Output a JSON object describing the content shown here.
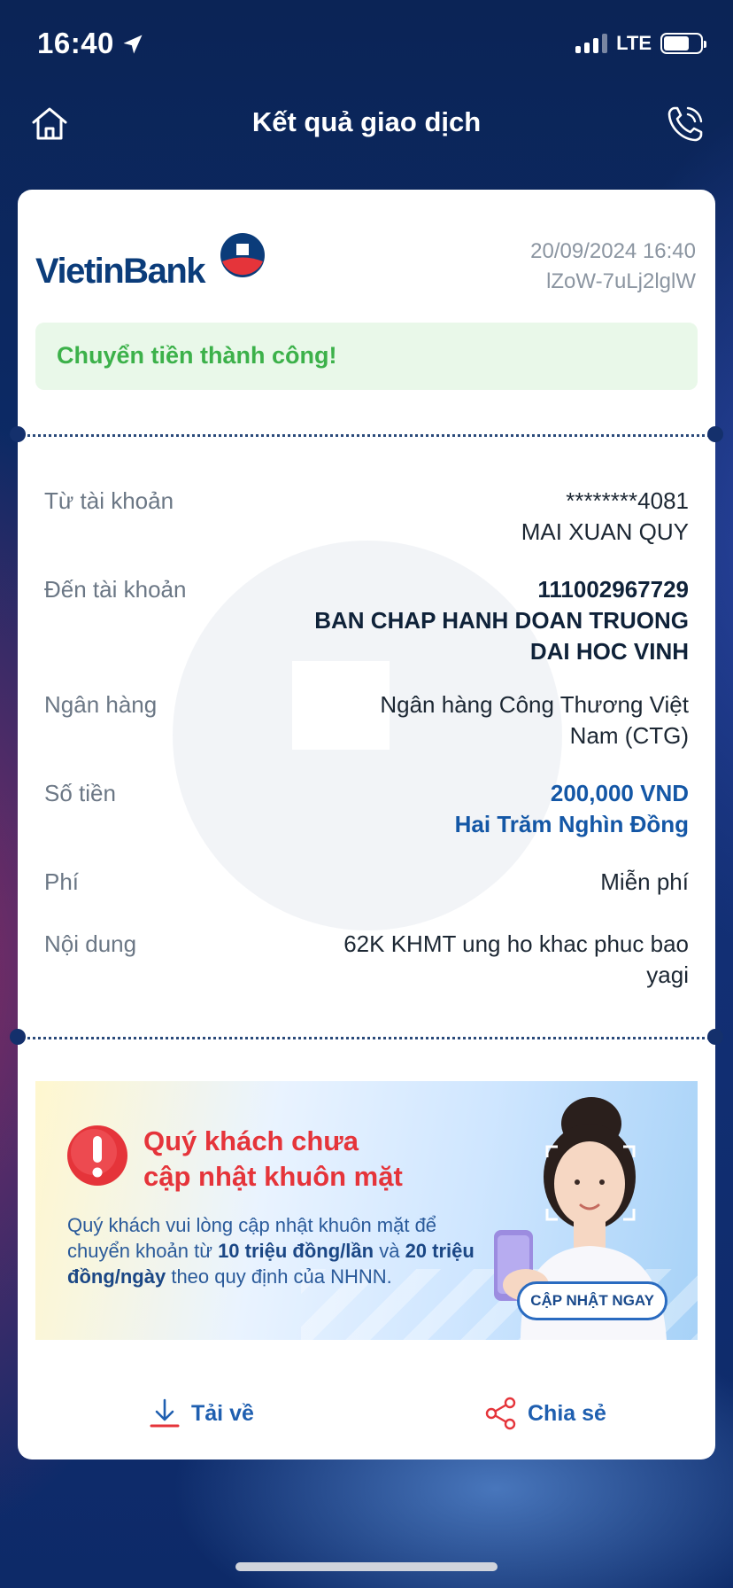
{
  "status_bar": {
    "time": "16:40",
    "network": "LTE"
  },
  "header": {
    "title": "Kết quả giao dịch"
  },
  "card": {
    "brand": "VietinBank",
    "date": "20/09/2024 16:40",
    "code": "lZoW-7uLj2lglW",
    "success_message": "Chuyển tiền thành công!"
  },
  "details": {
    "from_label": "Từ tài khoản",
    "from_account": "********4081",
    "from_name": "MAI XUAN QUY",
    "to_label": "Đến tài khoản",
    "to_account": "111002967729",
    "to_name_line1": "BAN CHAP HANH DOAN TRUONG",
    "to_name_line2": "DAI HOC VINH",
    "bank_label": "Ngân hàng",
    "bank_line1": "Ngân hàng Công Thương Việt",
    "bank_line2": "Nam (CTG)",
    "amount_label": "Số tiền",
    "amount": "200,000 VND",
    "amount_words": "Hai Trăm Nghìn Đồng",
    "fee_label": "Phí",
    "fee": "Miễn phí",
    "content_label": "Nội dung",
    "content_line1": "62K KHMT ung ho khac phuc bao",
    "content_line2": "yagi"
  },
  "banner": {
    "title_line1": "Quý khách chưa",
    "title_line2": "cập nhật khuôn mặt",
    "desc_1": "Quý khách vui lòng cập nhật khuôn mặt để chuyển khoản từ ",
    "desc_bold_1": "10 triệu đồng/lần",
    "desc_2": " và ",
    "desc_bold_2": "20 triệu đồng/ngày",
    "desc_3": " theo quy định của NHNN.",
    "button": "CẬP NHẬT NGAY"
  },
  "actions": {
    "download": "Tải về",
    "share": "Chia sẻ"
  },
  "colors": {
    "brand_blue": "#0b3c7a",
    "brand_red": "#e5343a",
    "success_green": "#3cb14a",
    "link_blue": "#1f5fb0"
  }
}
